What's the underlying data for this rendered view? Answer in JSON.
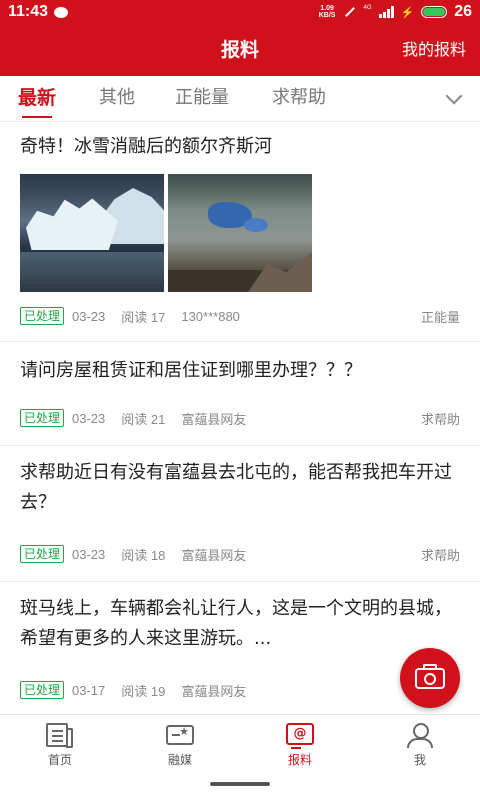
{
  "status_bar": {
    "time": "11:43",
    "net_speed_value": "1.09",
    "net_speed_unit": "KB/S",
    "network_type": "4G",
    "battery_level": "26",
    "battery_color": "#34c759"
  },
  "header": {
    "title": "报料",
    "action_label": "我的报料"
  },
  "tabs": [
    {
      "label": "最新",
      "active": true
    },
    {
      "label": "其他",
      "active": false
    },
    {
      "label": "正能量",
      "active": false
    },
    {
      "label": "求帮助",
      "active": false
    }
  ],
  "posts": [
    {
      "title": "奇特！冰雪消融后的额尔齐斯河",
      "status": "已处理",
      "date": "03-23",
      "reads": "阅读 17",
      "author": "130***880",
      "category": "正能量",
      "images": [
        "ice-blocks-image",
        "ice-cave-image"
      ]
    },
    {
      "title": "请问房屋租赁证和居住证到哪里办理？？？",
      "status": "已处理",
      "date": "03-23",
      "reads": "阅读 21",
      "author": "富蕴县网友",
      "category": "求帮助"
    },
    {
      "title": "求帮助近日有没有富蕴县去北屯的，能否帮我把车开过去？",
      "status": "已处理",
      "date": "03-23",
      "reads": "阅读 18",
      "author": "富蕴县网友",
      "category": "求帮助"
    },
    {
      "title": "斑马线上，车辆都会礼让行人，这是一个文明的县城，希望有更多的人来这里游玩。...",
      "status": "已处理",
      "date": "03-17",
      "reads": "阅读 19",
      "author": "富蕴县网友",
      "category": ""
    }
  ],
  "fab": {
    "icon": "camera-icon"
  },
  "bottom_nav": [
    {
      "label": "首页",
      "icon": "home-icon",
      "active": false
    },
    {
      "label": "融媒",
      "icon": "media-icon",
      "active": false
    },
    {
      "label": "报料",
      "icon": "report-icon",
      "active": true
    },
    {
      "label": "我",
      "icon": "profile-icon",
      "active": false
    }
  ],
  "colors": {
    "brand_red": "#d0111b",
    "status_green": "#22a447"
  }
}
